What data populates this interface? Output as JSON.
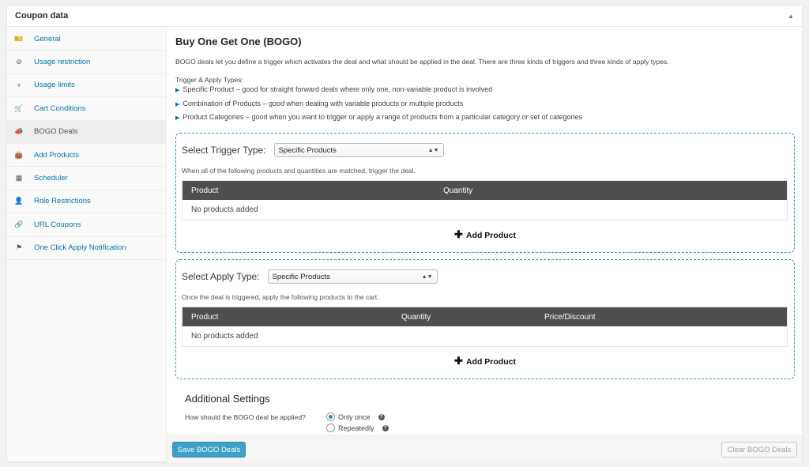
{
  "panel": {
    "title": "Coupon data"
  },
  "sidebar": {
    "items": [
      {
        "label": "General",
        "icon": "ticket-icon"
      },
      {
        "label": "Usage restriction",
        "icon": "block-icon"
      },
      {
        "label": "Usage limits",
        "icon": "plus-icon"
      },
      {
        "label": "Cart Conditions",
        "icon": "cart-icon"
      },
      {
        "label": "BOGO Deals",
        "icon": "megaphone-icon",
        "active": true
      },
      {
        "label": "Add Products",
        "icon": "bag-icon"
      },
      {
        "label": "Scheduler",
        "icon": "calendar-icon"
      },
      {
        "label": "Role Restrictions",
        "icon": "user-icon"
      },
      {
        "label": "URL Coupons",
        "icon": "link-icon"
      },
      {
        "label": "One Click Apply Notification",
        "icon": "flag-icon"
      }
    ]
  },
  "main": {
    "title": "Buy One Get One (BOGO)",
    "description": "BOGO deals let you define a trigger which activates the deal and what should be applied in the deal. There are three kinds of triggers and three kinds of apply types.",
    "types_label": "Trigger & Apply Types:",
    "types": [
      "Specific Product – good for straight forward deals where only one, non-variable product is involved",
      "Combination of Products – good when dealing with variable products or multiple products",
      "Product Categories – good when you want to trigger or apply a range of products from a particular category or set of categories"
    ]
  },
  "trigger": {
    "select_label": "Select Trigger Type:",
    "select_value": "Specific Products",
    "help": "When all of the following products and quantities are matched, trigger the deal.",
    "columns": [
      "Product",
      "Quantity"
    ],
    "empty": "No products added",
    "add_label": "Add Product"
  },
  "apply": {
    "select_label": "Select Apply Type:",
    "select_value": "Specific Products",
    "help": "Once the deal is triggered, apply the following products to the cart.",
    "columns": [
      "Product",
      "Quantity",
      "Price/Discount"
    ],
    "empty": "No products added",
    "add_label": "Add Product"
  },
  "settings": {
    "title": "Additional Settings",
    "question": "How should the BOGO deal be applied?",
    "options": [
      {
        "label": "Only once",
        "checked": true
      },
      {
        "label": "Repeatedly",
        "checked": false
      }
    ]
  },
  "footer": {
    "save_label": "Save BOGO Deals",
    "clear_label": "Clear BOGO Deals"
  }
}
